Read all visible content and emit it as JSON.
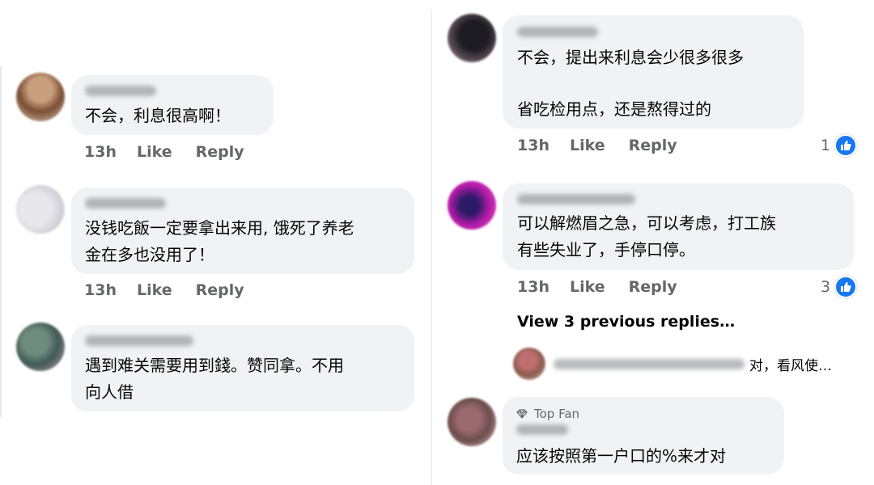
{
  "left_column": [
    {
      "text_lines": [
        "不会，利息很高啊！"
      ],
      "time": "13h",
      "like": "Like",
      "reply": "Reply"
    },
    {
      "text_lines": [
        "没钱吃飯一定要拿出来用, 饿死了养老",
        "金在多也没用了！"
      ],
      "time": "13h",
      "like": "Like",
      "reply": "Reply"
    },
    {
      "text_lines": [
        "遇到难关需要用到錢。赞同拿。不用",
        "向人借"
      ]
    }
  ],
  "right_column": [
    {
      "text_lines": [
        "不会，提出来利息会少很多很多",
        "",
        "省吃检用点，还是熬得过的"
      ],
      "time": "13h",
      "like": "Like",
      "reply": "Reply",
      "reaction_count": "1"
    },
    {
      "text_lines": [
        "可以解燃眉之急，可以考虑，打工族",
        "有些失业了，手停口停。"
      ],
      "time": "13h",
      "like": "Like",
      "reply": "Reply",
      "reaction_count": "3",
      "view_previous": "View 3 previous replies…",
      "reply_preview": "对，看风使…"
    },
    {
      "badge": "Top Fan",
      "text_lines": [
        "应该按照第一户口的%来才对"
      ]
    }
  ],
  "icons": {
    "like_reaction": "thumbs-up-icon",
    "top_fan_badge": "diamond-icon",
    "reply_arrow": "reply-arrow-icon"
  },
  "colors": {
    "bubble": "#f0f2f5",
    "meta_text": "#65676b",
    "like_blue": "#1877f2",
    "text": "#050505"
  }
}
